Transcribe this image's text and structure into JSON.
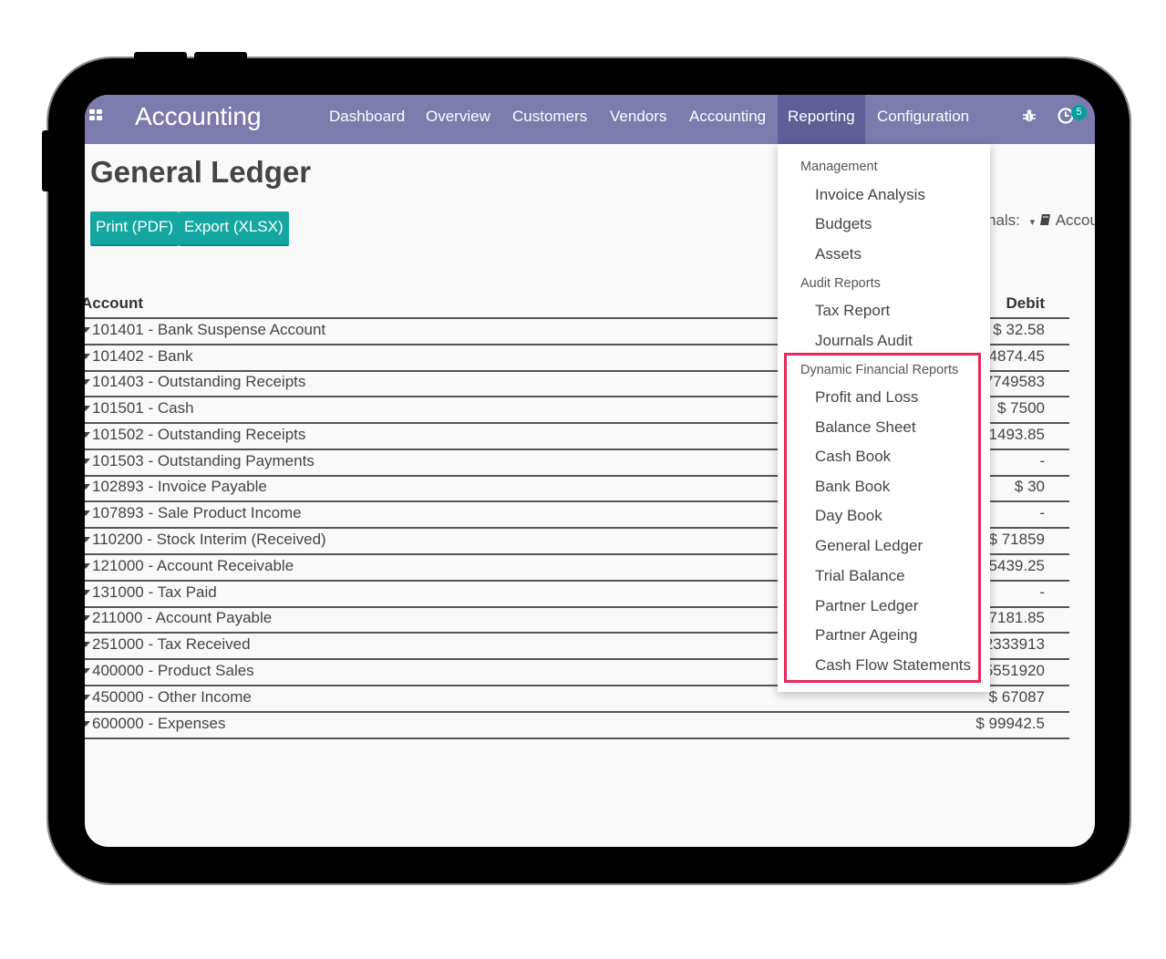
{
  "navbar": {
    "app_name": "Accounting",
    "items": [
      {
        "label": "Dashboard"
      },
      {
        "label": "Overview"
      },
      {
        "label": "Customers"
      },
      {
        "label": "Vendors"
      },
      {
        "label": "Accounting"
      },
      {
        "label": "Reporting"
      },
      {
        "label": "Configuration"
      }
    ],
    "active_item": "Reporting",
    "activity_badge": "5",
    "accent_color": "#7c7bad",
    "icons": [
      "apps-grid-icon",
      "bug-icon",
      "activity-clock-icon"
    ]
  },
  "page": {
    "title": "General Ledger",
    "print_button": "Print (PDF)",
    "export_button": "Export (XLSX)",
    "journals_label": "nals:",
    "journals_value": "Accou"
  },
  "table": {
    "col_account": "Account",
    "col_debit": "Debit",
    "rows": [
      {
        "account": "101401 - Bank Suspense Account",
        "debit": "$ 32.58"
      },
      {
        "account": "101402 - Bank",
        "debit": "4874.45"
      },
      {
        "account": "101403 - Outstanding Receipts",
        "debit": "7749583"
      },
      {
        "account": "101501 - Cash",
        "debit": "$ 7500"
      },
      {
        "account": "101502 - Outstanding Receipts",
        "debit": "1493.85"
      },
      {
        "account": "101503 - Outstanding Payments",
        "debit": "-"
      },
      {
        "account": "102893 - Invoice Payable",
        "debit": "$ 30"
      },
      {
        "account": "107893 - Sale Product Income",
        "debit": "-"
      },
      {
        "account": "110200 - Stock Interim (Received)",
        "debit": "$ 71859"
      },
      {
        "account": "121000 - Account Receivable",
        "debit": "5439.25"
      },
      {
        "account": "131000 - Tax Paid",
        "debit": "-"
      },
      {
        "account": "211000 - Account Payable",
        "debit": "7181.85"
      },
      {
        "account": "251000 - Tax Received",
        "debit": "2333913"
      },
      {
        "account": "400000 - Product Sales",
        "debit": "5551920"
      },
      {
        "account": "450000 - Other Income",
        "debit": "$ 67087"
      },
      {
        "account": "600000 - Expenses",
        "debit": "$ 99942.5"
      }
    ]
  },
  "dropdown": {
    "management_header": "Management",
    "management_items": [
      "Invoice Analysis",
      "Budgets",
      "Assets"
    ],
    "audit_header": "Audit Reports",
    "audit_items": [
      "Tax Report",
      "Journals Audit"
    ],
    "dynamic_header": "Dynamic Financial Reports",
    "dynamic_items": [
      "Profit and Loss",
      "Balance Sheet",
      "Cash Book",
      "Bank Book",
      "Day Book",
      "General Ledger",
      "Trial Balance",
      "Partner Ledger",
      "Partner Ageing",
      "Cash Flow Statements"
    ],
    "highlight_color": "#e8275a"
  }
}
